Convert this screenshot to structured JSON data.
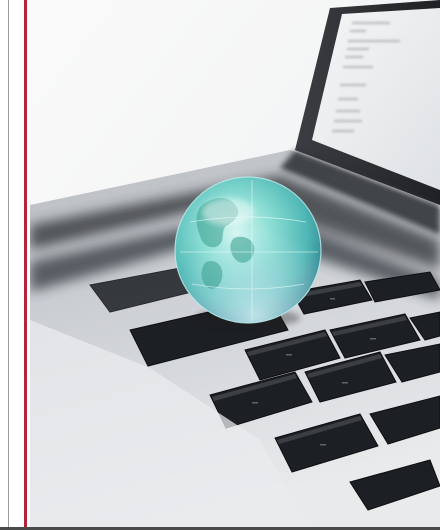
{
  "scene": {
    "subject": "globe-on-laptop-keyboard",
    "colors": {
      "accent_rule": "#b3263a",
      "keyboard_key": "#1f2226",
      "laptop_body": "#c8ccd0",
      "globe_tint": "#6fd0c4"
    },
    "icons": {
      "globe": "globe-icon",
      "laptop": "laptop-icon"
    }
  }
}
